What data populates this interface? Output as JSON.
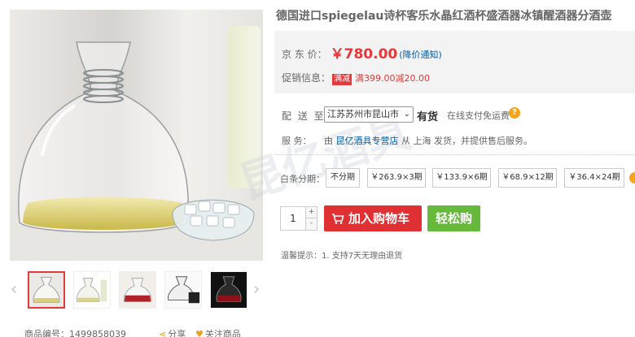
{
  "product": {
    "title": "德国进口spiegelau诗杯客乐水晶红酒杯盛酒器冰镇醒酒器分酒壶"
  },
  "price": {
    "label": "京 东 价：",
    "value": "￥780.00",
    "notice": "(降价通知)"
  },
  "promo": {
    "label": "促销信息：",
    "tag": "满减",
    "text": "满399.00减20.00"
  },
  "shipping": {
    "label": "配 送 至：",
    "region": "江苏苏州市昆山市",
    "stock": "有货",
    "note": "在线支付免运费"
  },
  "service": {
    "label": "服    务：",
    "prefix": "由",
    "store": "昆亿酒具专营店",
    "suffix": "从 上海 发货，并提供售后服务。"
  },
  "installments": {
    "label": "白条分期：",
    "options": [
      "不分期",
      "￥263.9×3期",
      "￥133.9×6期",
      "￥68.9×12期",
      "￥36.4×24期"
    ]
  },
  "buy": {
    "quantity": "1",
    "plus": "+",
    "minus": "-",
    "add_to_cart": "加入购物车",
    "easy_buy": "轻松购"
  },
  "tips": "温馨提示：1.  支持7天无理由退货",
  "meta": {
    "sku": "商品编号：1499858039",
    "share": "分享",
    "follow": "关注商品"
  },
  "watermark": "昆亿酒具",
  "colors": {
    "price_red": "#e4393c",
    "cart_red": "#df3033",
    "easy_green": "#67b93c",
    "link_blue": "#005ea7",
    "help_orange": "#f4a51a"
  }
}
